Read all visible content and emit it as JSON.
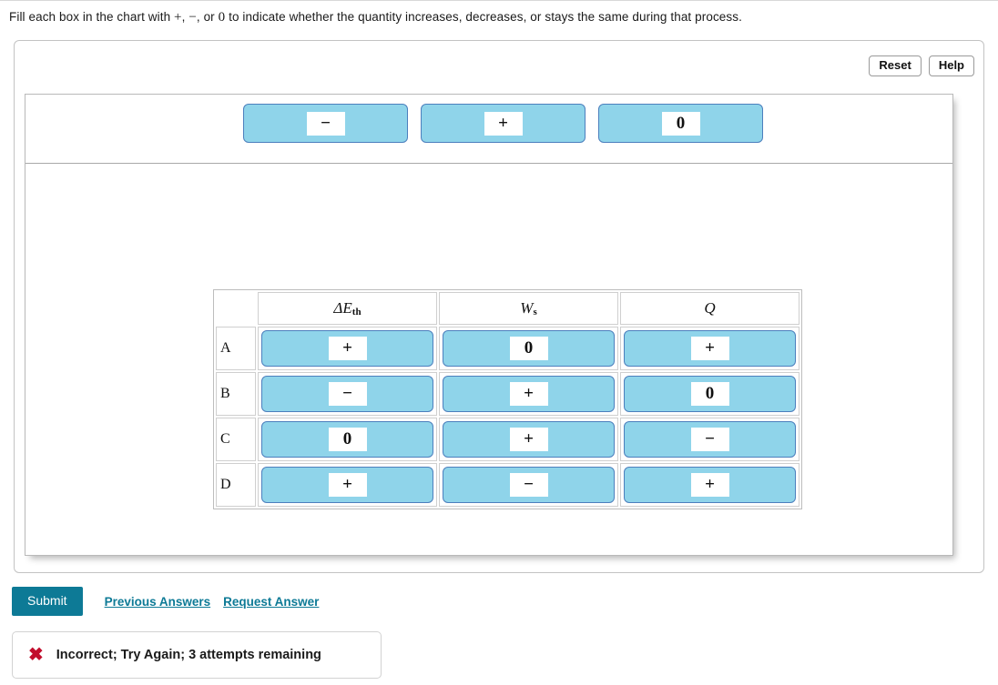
{
  "prompt": {
    "before": "Fill each box in the chart with ",
    "sym1": "+",
    "mid1": ", ",
    "sym2": "−",
    "mid2": ", or ",
    "sym3": "0",
    "after": " to indicate whether the quantity increases, decreases, or stays the same during that process."
  },
  "toolbar": {
    "reset_label": "Reset",
    "help_label": "Help"
  },
  "answer_bank": {
    "items": [
      {
        "label": "−",
        "name": "minus"
      },
      {
        "label": "+",
        "name": "plus"
      },
      {
        "label": "0",
        "name": "zero"
      }
    ]
  },
  "chart": {
    "corner_label": "",
    "columns": [
      {
        "symbol": "ΔE",
        "sub": "th"
      },
      {
        "symbol": "W",
        "sub": "s"
      },
      {
        "symbol": "Q",
        "sub": ""
      }
    ],
    "rows": [
      {
        "label": "A",
        "values": [
          "+",
          "0",
          "+"
        ]
      },
      {
        "label": "B",
        "values": [
          "−",
          "+",
          "0"
        ]
      },
      {
        "label": "C",
        "values": [
          "0",
          "+",
          "−"
        ]
      },
      {
        "label": "D",
        "values": [
          "+",
          "−",
          "+"
        ]
      }
    ]
  },
  "actions": {
    "submit_label": "Submit",
    "previous_answers_label": "Previous Answers",
    "request_answer_label": "Request Answer"
  },
  "feedback": {
    "icon": "cross-icon",
    "message": "Incorrect; Try Again; 3 attempts remaining"
  },
  "colors": {
    "tile_fill": "#8fd4ea",
    "tile_border": "#4c7fbd",
    "accent": "#0d7a96",
    "error": "#c20e2d"
  }
}
